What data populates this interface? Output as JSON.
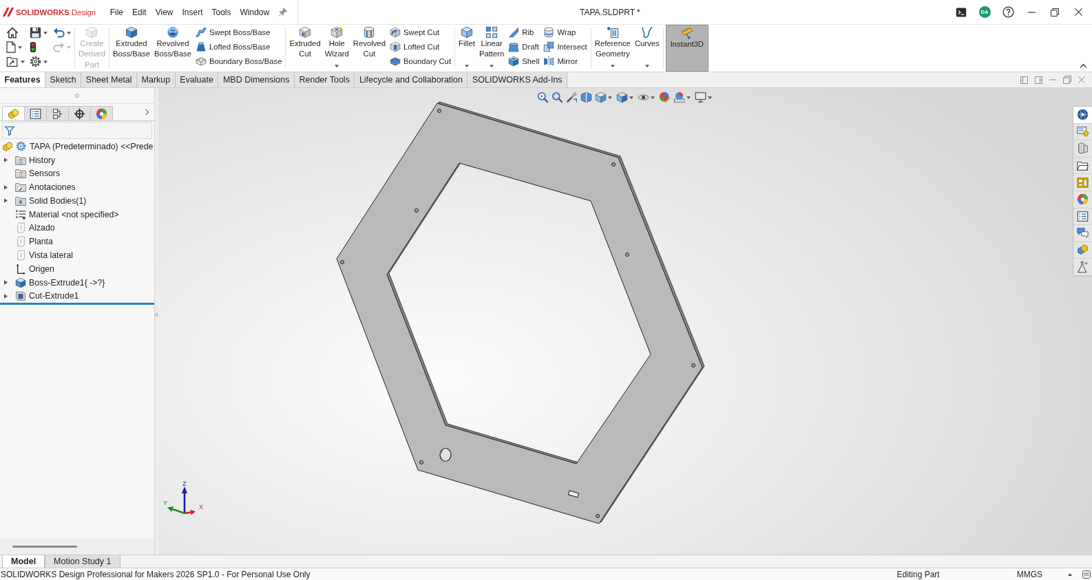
{
  "title_bar": {
    "brand": "**SOLIDWORKS** Design",
    "menus": [
      "File",
      "Edit",
      "View",
      "Insert",
      "Tools",
      "Window"
    ],
    "title": "TAPA.SLDPRT *",
    "user_initials": "DA"
  },
  "ribbon": [
    {
      "kind": "quick",
      "items": [
        {
          "dropdown": false,
          "disabled": false
        },
        {
          "dropdown": true,
          "disabled": false
        },
        {
          "dropdown": true,
          "disabled": false
        },
        {
          "dropdown": true,
          "disabled": false
        },
        {
          "dropdown": false,
          "disabled": false
        },
        {
          "dropdown": true,
          "disabled": false
        },
        {
          "dropdown": true,
          "disabled": false
        },
        {
          "dropdown": true,
          "disabled": true
        }
      ]
    },
    {
      "kind": "commands",
      "items": [
        {
          "kind": "large",
          "label": "Create Derived Part",
          "dropdown": false,
          "disabled": true
        }
      ]
    },
    {
      "kind": "commands",
      "items": [
        {
          "kind": "large",
          "label": "Extruded Boss/Base",
          "dropdown": false,
          "disabled": false
        },
        {
          "kind": "large",
          "label": "Revolved Boss/Base",
          "dropdown": false,
          "disabled": false
        },
        {
          "kind": "stack",
          "items": [
            {
              "label": "Swept Boss/Base"
            },
            {
              "label": "Lofted Boss/Base"
            },
            {
              "label": "Boundary Boss/Base"
            }
          ]
        }
      ]
    },
    {
      "kind": "commands",
      "items": [
        {
          "kind": "large",
          "label": "Extruded Cut",
          "dropdown": false,
          "disabled": false
        },
        {
          "kind": "large",
          "label": "Hole Wizard",
          "dropdown": true,
          "disabled": false
        },
        {
          "kind": "large",
          "label": "Revolved Cut",
          "dropdown": false,
          "disabled": false
        },
        {
          "kind": "stack",
          "items": [
            {
              "label": "Swept Cut"
            },
            {
              "label": "Lofted Cut"
            },
            {
              "label": "Boundary Cut"
            }
          ]
        }
      ]
    },
    {
      "kind": "commands",
      "items": [
        {
          "kind": "large",
          "label": "Fillet",
          "dropdown": true,
          "disabled": false
        },
        {
          "kind": "large",
          "label": "Linear Pattern",
          "dropdown": true,
          "disabled": false
        },
        {
          "kind": "stack",
          "items": [
            {
              "label": "Rib"
            },
            {
              "label": "Draft"
            },
            {
              "label": "Shell"
            }
          ]
        },
        {
          "kind": "stack",
          "items": [
            {
              "label": "Wrap"
            },
            {
              "label": "Intersect"
            },
            {
              "label": "Mirror"
            }
          ]
        }
      ]
    },
    {
      "kind": "commands",
      "items": [
        {
          "kind": "large",
          "label": "Reference Geometry",
          "dropdown": true,
          "disabled": false
        },
        {
          "kind": "large",
          "label": "Curves",
          "dropdown": true,
          "disabled": false
        }
      ]
    },
    {
      "kind": "commands",
      "items": [
        {
          "kind": "toggle",
          "label": "Instant3D",
          "on": true
        }
      ]
    }
  ],
  "command_tabs": [
    {
      "label": "Features",
      "selected": true
    },
    {
      "label": "Sketch",
      "selected": false
    },
    {
      "label": "Sheet Metal",
      "selected": false
    },
    {
      "label": "Markup",
      "selected": false
    },
    {
      "label": "Evaluate",
      "selected": false
    },
    {
      "label": "MBD Dimensions",
      "selected": false
    },
    {
      "label": "Render Tools",
      "selected": false
    },
    {
      "label": "Lifecycle and Collaboration",
      "selected": false
    },
    {
      "label": "SOLIDWORKS Add-Ins",
      "selected": false
    }
  ],
  "feature_manager": {
    "tabs": [
      {
        "selected": true
      },
      {
        "selected": false
      },
      {
        "selected": false
      },
      {
        "selected": false
      },
      {
        "selected": false
      }
    ],
    "tree": {
      "label": "TAPA (Predeterminado) <<Prede",
      "children": [
        {
          "label": "History",
          "expandable": true
        },
        {
          "label": "Sensors",
          "expandable": false
        },
        {
          "label": "Anotaciones",
          "expandable": true
        },
        {
          "label": "Solid Bodies(1)",
          "expandable": true
        },
        {
          "label": "Material <not specified>",
          "expandable": false
        },
        {
          "label": "Alzado",
          "expandable": false
        },
        {
          "label": "Planta",
          "expandable": false
        },
        {
          "label": "Vista lateral",
          "expandable": false
        },
        {
          "label": "Origen",
          "expandable": false
        },
        {
          "label": "Boss-Extrude1{ ->?}",
          "expandable": true
        },
        {
          "label": "Cut-Extrude1",
          "expandable": true
        }
      ]
    }
  },
  "viewport": {
    "triad": [
      {
        "label": "Z",
        "color": "#1b1bb0"
      },
      {
        "label": "Y",
        "color": "#1e8a1e"
      },
      {
        "label": "X",
        "color": "#e02020"
      }
    ]
  },
  "task_pane": [
    {
      "selected": true
    },
    {
      "selected": false
    },
    {
      "selected": false
    },
    {
      "selected": false
    },
    {
      "selected": false
    },
    {
      "selected": false
    },
    {
      "selected": false
    },
    {
      "selected": false
    },
    {
      "selected": false
    },
    {
      "selected": false
    }
  ],
  "bottom_tabs": [
    {
      "label": "Model",
      "selected": true
    },
    {
      "label": "Motion Study 1",
      "selected": false
    }
  ],
  "status_bar": {
    "message": "SOLIDWORKS Design Professional for Makers 2026 SP1.0 - For Personal Use Only",
    "mode": "Editing Part",
    "units": "MMGS"
  }
}
